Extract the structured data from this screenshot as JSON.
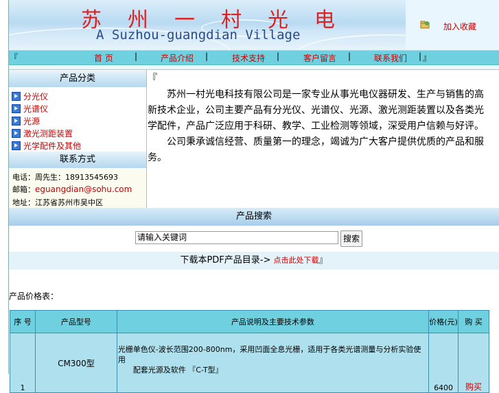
{
  "banner": {
    "title": "苏州一村光电",
    "subtitle": "A Suzhou-guangdian Village",
    "bookmark_label": "加入收藏"
  },
  "nav": {
    "left_edge": "『",
    "items": [
      "首 页",
      "产品介绍",
      "技术支持",
      "客户留言",
      "联系我们"
    ],
    "separator": "|",
    "right_edge": "』"
  },
  "sidebar": {
    "products_heading": "产品分类",
    "items": [
      "分光仪",
      "光谱仪",
      "光源",
      "激光测距装置",
      "光学配件及其他"
    ],
    "contact_heading": "联系方式",
    "phone_label": "电话：周先生：",
    "phone": "18913545693",
    "email_label": "邮箱：",
    "email": "eguangdian@sohu.com",
    "address": "地址：江苏省苏州市吴中区"
  },
  "main": {
    "blank_line": "『",
    "paragraphs": [
      "苏州一村光电科技有限公司是一家专业从事光电仪器研发、生产与销售的高新技术企业，公司主要产品有分光仪、光谱仪、光源、激光测距装置以及各类光学配件，产品广泛应用于科研、教学、工业检测等领域，深受用户信赖与好评。",
      "公司秉承诚信经营、质量第一的理念，竭诚为广大客户提供优质的产品和服务。"
    ]
  },
  "search": {
    "heading": "产品搜索",
    "input_value": "请输入关键词",
    "button_label": "搜索"
  },
  "pdf_bar": {
    "prefix": "下载本PDF产品目录",
    "arrow": "->",
    "link_label": "点击此处下载",
    "suffix": "』"
  },
  "products": {
    "section_title": "产品价格表：",
    "headers": [
      "序 号",
      "产品型号",
      "产品说明及主要技术参数",
      "价格(元)",
      "购 买"
    ],
    "rows": [
      {
        "index": "1",
        "model": "CM300型",
        "desc_line1": "光栅单色仪-波长范围200-800nm，采用凹面全息光栅，适用于各类光谱测量与分析实验使用",
        "desc_line2": "配套光源及软件 『C-T型』",
        "price": "6400",
        "buy": "购买"
      }
    ]
  }
}
